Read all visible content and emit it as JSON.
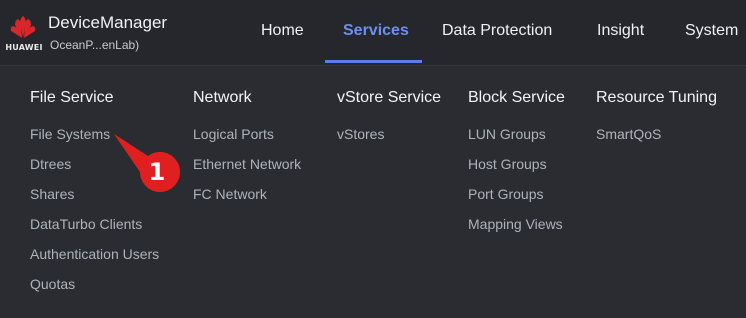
{
  "header": {
    "logo_text": "HUAWEI",
    "app_title": "DeviceManager",
    "app_subtitle": "OceanP...enLab)",
    "nav": [
      "Home",
      "Services",
      "Data Protection",
      "Insight",
      "System"
    ],
    "active_nav": "Services"
  },
  "menu": {
    "columns": [
      {
        "title": "File Service",
        "items": [
          "File Systems",
          "Dtrees",
          "Shares",
          "DataTurbo Clients",
          "Authentication Users",
          "Quotas"
        ]
      },
      {
        "title": "Network",
        "items": [
          "Logical Ports",
          "Ethernet Network",
          "FC Network"
        ]
      },
      {
        "title": "vStore Service",
        "items": [
          "vStores"
        ]
      },
      {
        "title": "Block Service",
        "items": [
          "LUN Groups",
          "Host Groups",
          "Port Groups",
          "Mapping Views"
        ]
      },
      {
        "title": "Resource Tuning",
        "items": [
          "SmartQoS"
        ]
      }
    ]
  },
  "annotation": {
    "step_number": "1",
    "color": "#e02020"
  },
  "colors": {
    "accent": "#6d8ff0",
    "background": "#2a2c31",
    "brand_red": "#d8262b"
  }
}
